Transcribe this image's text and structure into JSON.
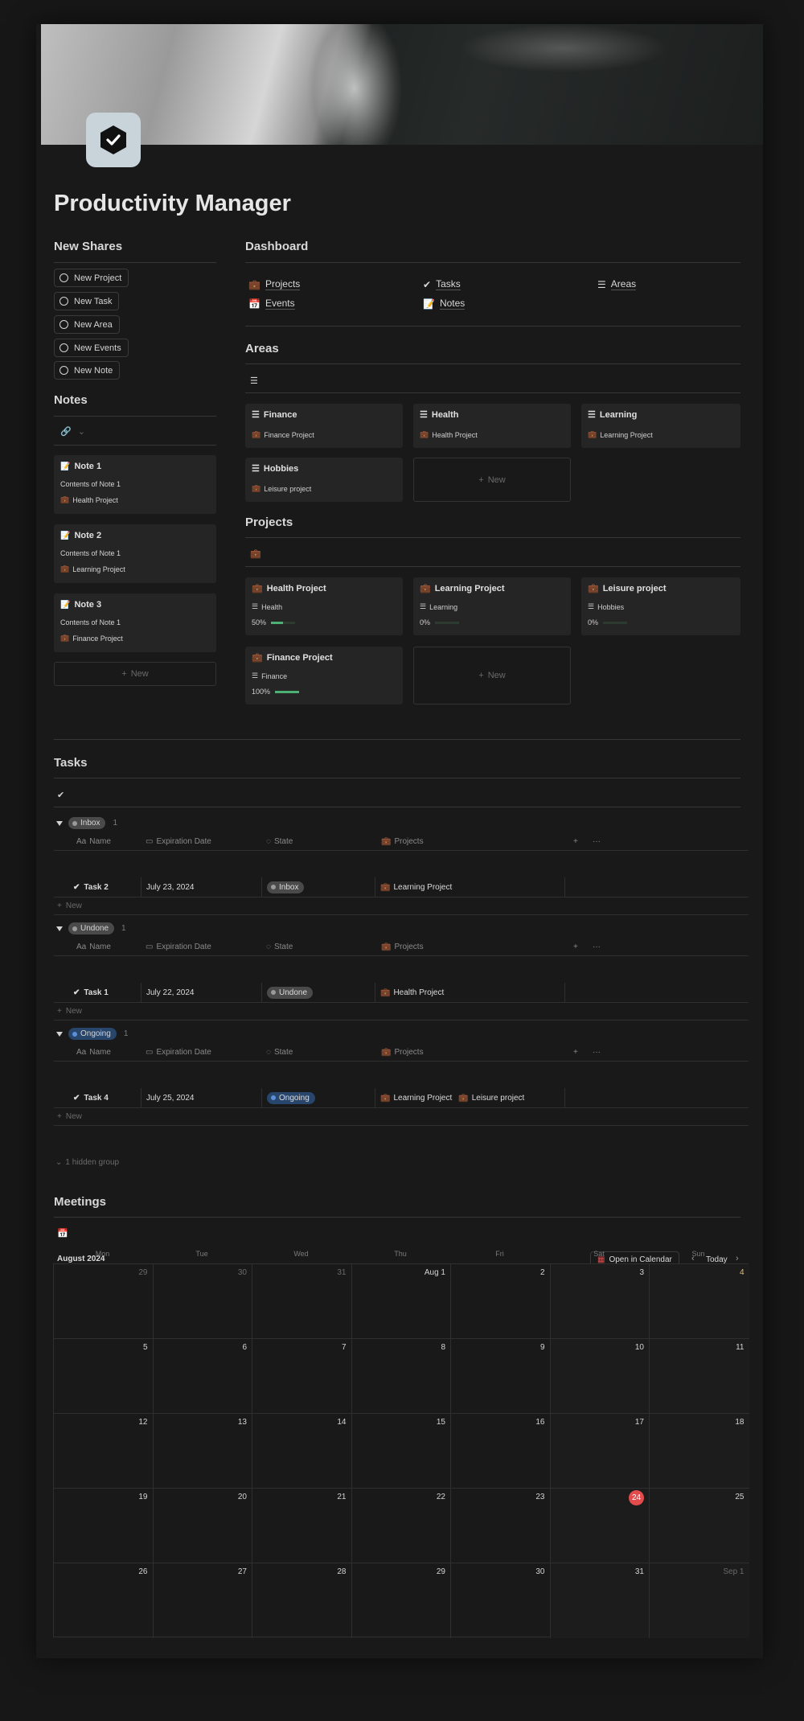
{
  "page": {
    "title": "Productivity Manager"
  },
  "new_shares": {
    "heading": "New Shares",
    "buttons": [
      "New Project",
      "New Task",
      "New Area",
      "New Events",
      "New Note"
    ]
  },
  "notes": {
    "heading": "Notes",
    "items": [
      {
        "title": "Note 1",
        "content": "Contents of Note 1",
        "project": "Health Project"
      },
      {
        "title": "Note 2",
        "content": "Contents of Note 1",
        "project": "Learning Project"
      },
      {
        "title": "Note 3",
        "content": "Contents of Note 1",
        "project": "Finance Project"
      }
    ],
    "new_label": "New"
  },
  "dashboard": {
    "heading": "Dashboard",
    "links": [
      "Projects",
      "Tasks",
      "Areas",
      "Events",
      "Notes"
    ]
  },
  "areas": {
    "heading": "Areas",
    "cards": [
      {
        "title": "Finance",
        "project": "Finance Project"
      },
      {
        "title": "Health",
        "project": "Health Project"
      },
      {
        "title": "Learning",
        "project": "Learning Project"
      },
      {
        "title": "Hobbies",
        "project": "Leisure project"
      }
    ],
    "new_label": "New"
  },
  "projects": {
    "heading": "Projects",
    "cards": [
      {
        "title": "Health Project",
        "area": "Health",
        "progress_label": "50%",
        "progress": 0.5
      },
      {
        "title": "Learning Project",
        "area": "Learning",
        "progress_label": "0%",
        "progress": 0
      },
      {
        "title": "Leisure project",
        "area": "Hobbies",
        "progress_label": "0%",
        "progress": 0
      },
      {
        "title": "Finance Project",
        "area": "Finance",
        "progress_label": "100%",
        "progress": 1
      }
    ],
    "new_label": "New"
  },
  "tasks": {
    "heading": "Tasks",
    "columns": {
      "name": "Name",
      "expiration": "Expiration Date",
      "state": "State",
      "projects": "Projects",
      "name_prefix": "Aa"
    },
    "groups": [
      {
        "label": "Inbox",
        "count": "1",
        "color": "#5a5a5a",
        "rows": [
          {
            "name": "Task 2",
            "date": "July 23, 2024",
            "state": "Inbox",
            "projects": [
              "Learning Project"
            ]
          }
        ]
      },
      {
        "label": "Undone",
        "count": "1",
        "color": "#5a5a5a",
        "rows": [
          {
            "name": "Task 1",
            "date": "July 22, 2024",
            "state": "Undone",
            "projects": [
              "Health Project"
            ]
          }
        ]
      },
      {
        "label": "Ongoing",
        "count": "1",
        "color": "#28456c",
        "rows": [
          {
            "name": "Task 4",
            "date": "July 25, 2024",
            "state": "Ongoing",
            "projects": [
              "Learning Project",
              "Leisure project"
            ]
          }
        ]
      }
    ],
    "new_label": "New",
    "hidden_groups": "1 hidden group"
  },
  "meetings": {
    "heading": "Meetings",
    "month": "August 2024",
    "open_calendar": "Open in Calendar",
    "today_label": "Today",
    "days": [
      "Mon",
      "Tue",
      "Wed",
      "Thu",
      "Fri",
      "Sat",
      "Sun"
    ],
    "weeks": [
      [
        "29",
        "30",
        "31",
        "Aug 1",
        "2",
        "3",
        "4"
      ],
      [
        "5",
        "6",
        "7",
        "8",
        "9",
        "10",
        "11"
      ],
      [
        "12",
        "13",
        "14",
        "15",
        "16",
        "17",
        "18"
      ],
      [
        "19",
        "20",
        "21",
        "22",
        "23",
        "24",
        "25"
      ],
      [
        "26",
        "27",
        "28",
        "29",
        "30",
        "31",
        "Sep 1"
      ]
    ],
    "today": "24"
  }
}
